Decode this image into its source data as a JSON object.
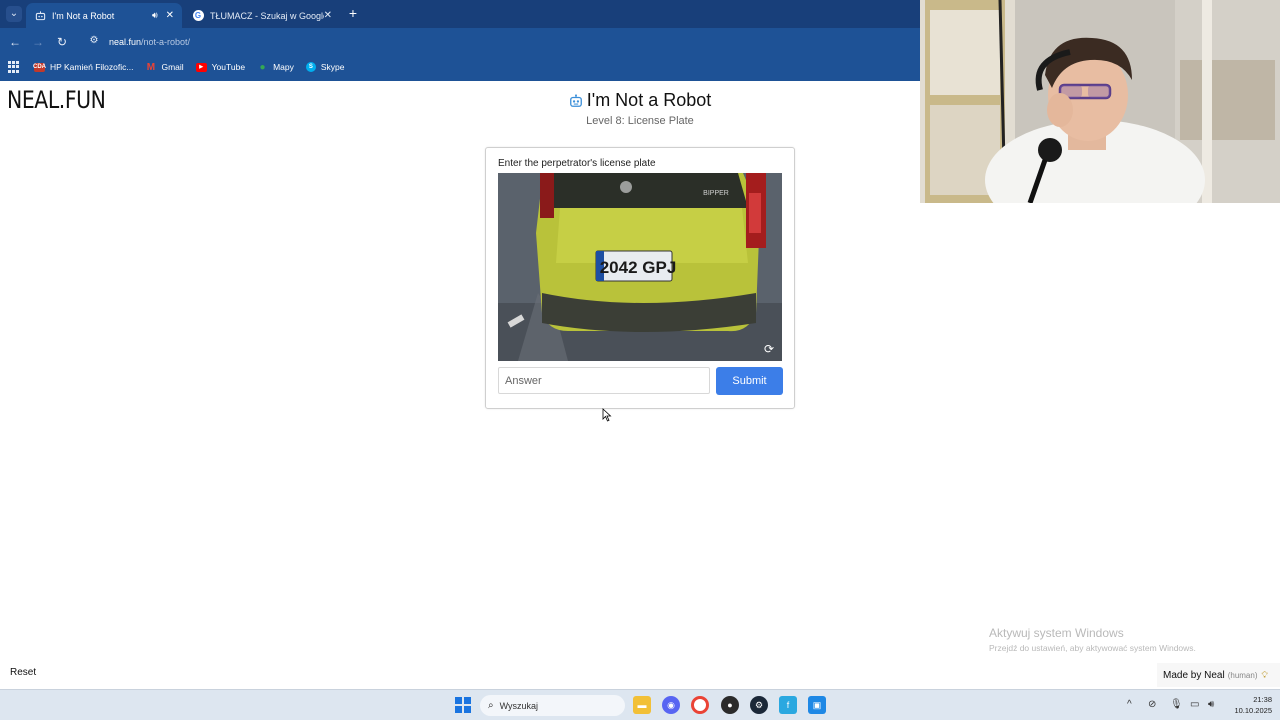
{
  "browser": {
    "tabs": [
      {
        "title": "I'm Not a Robot",
        "active": true
      },
      {
        "title": "TŁUMACZ - Szukaj w Google",
        "active": false
      }
    ],
    "url_domain": "neal.fun",
    "url_path": "/not-a-robot/",
    "bookmarks": [
      {
        "label": "HP Kamień Filozofic...",
        "icon": "hp-icon"
      },
      {
        "label": "Gmail",
        "icon": "gmail-icon"
      },
      {
        "label": "YouTube",
        "icon": "youtube-icon"
      },
      {
        "label": "Mapy",
        "icon": "maps-icon"
      },
      {
        "label": "Skype",
        "icon": "skype-icon"
      }
    ]
  },
  "page": {
    "logo": "NEAL.FUN",
    "title": "I'm Not a Robot",
    "level": "Level 8: License Plate",
    "instruction": "Enter the perpetrator's license plate",
    "plate_image_text": "2042 GPJ",
    "answer_placeholder": "Answer",
    "submit_label": "Submit",
    "reset_label": "Reset",
    "made_by": "Made by Neal",
    "made_by_note": "(human)"
  },
  "watermark": {
    "line1": "Aktywuj system Windows",
    "line2": "Przejdź do ustawień, aby aktywować system Windows."
  },
  "taskbar": {
    "search_placeholder": "Wyszukaj",
    "time": "21:38",
    "date": "10.10.2025"
  },
  "colors": {
    "chrome_bar": "#1e5296",
    "tab_strip": "#183f7a",
    "submit": "#3c7ee8",
    "taskbar": "#dde6f0"
  }
}
